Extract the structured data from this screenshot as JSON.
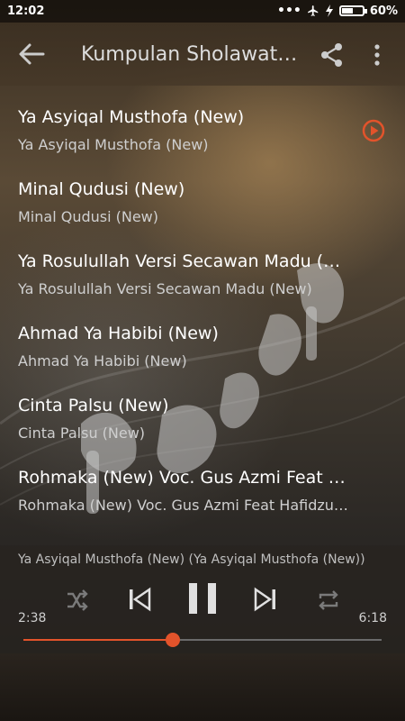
{
  "status_bar": {
    "time": "12:02",
    "battery_percent": "60%",
    "battery_level": 0.6,
    "icons": [
      "more-dots-icon",
      "airplane-icon",
      "charging-icon",
      "battery-icon"
    ]
  },
  "app_bar": {
    "title": "Kumpulan Sholawat…",
    "back_icon": "back-arrow-icon",
    "share_icon": "share-icon",
    "more_icon": "overflow-menu-icon"
  },
  "songs": [
    {
      "title": "Ya Asyiqal Musthofa (New)",
      "subtitle": "Ya Asyiqal Musthofa (New)",
      "playing": true
    },
    {
      "title": "Minal Qudusi (New)",
      "subtitle": "Minal Qudusi (New)",
      "playing": false
    },
    {
      "title": "Ya Rosulullah Versi Secawan Madu (New)",
      "subtitle": "Ya Rosulullah Versi Secawan Madu (New)",
      "playing": false
    },
    {
      "title": "Ahmad Ya Habibi (New)",
      "subtitle": "Ahmad Ya Habibi (New)",
      "playing": false
    },
    {
      "title": "Cinta Palsu (New)",
      "subtitle": "Cinta Palsu (New)",
      "playing": false
    },
    {
      "title": "Rohmaka (New) Voc. Gus Azmi Feat Ha…",
      "subtitle": "Rohmaka (New) Voc. Gus Azmi Feat Hafidzul…",
      "playing": false
    }
  ],
  "player": {
    "now_playing": "Ya Asyiqal Musthofa (New) (Ya Asyiqal Musthofa (New))",
    "elapsed": "2:38",
    "duration": "6:18",
    "progress_fraction": 0.418,
    "accent_color": "#e2532b",
    "controls": [
      "shuffle-icon",
      "previous-icon",
      "pause-icon",
      "next-icon",
      "repeat-icon"
    ]
  }
}
